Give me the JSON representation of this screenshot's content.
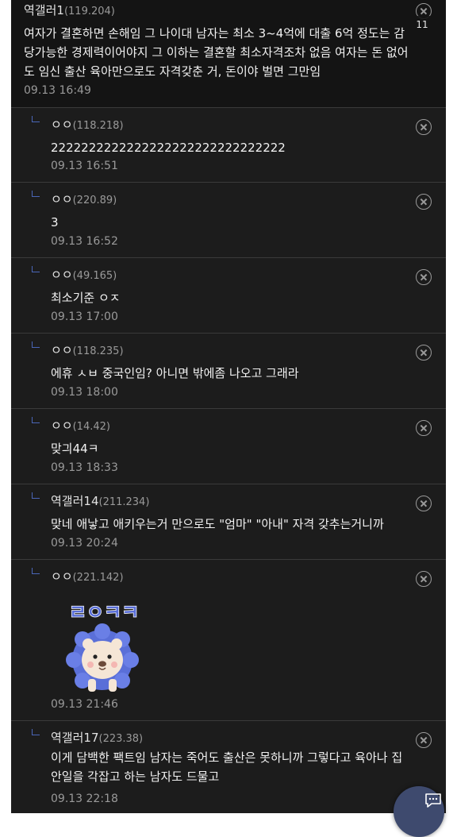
{
  "overlay": {
    "counter_badge": "11"
  },
  "comments": [
    {
      "author": "역갤러1",
      "ip": "(119.204)",
      "body": "여자가 결혼하면 손해임 그 나이대 남자는 최소 3~4억에 대출 6억 정도는 감\n당가능한 경제력이어야지 그 이하는 결혼할 최소자격조차 없음 여자는 돈 없어\n도 임신 출산 육아만으로도 자격갖춘 거, 돈이야 벌면 그만임",
      "date": "09.13 16:49"
    },
    {
      "author": "ㅇㅇ",
      "ip": "(118.218)",
      "body": "2222222222222222222222222222222",
      "date": "09.13 16:51"
    },
    {
      "author": "ㅇㅇ",
      "ip": "(220.89)",
      "body": "3",
      "date": "09.13 16:52"
    },
    {
      "author": "ㅇㅇ",
      "ip": "(49.165)",
      "body": "최소기준 ㅇㅈ",
      "date": "09.13 17:00"
    },
    {
      "author": "ㅇㅇ",
      "ip": "(118.235)",
      "body": "에휴 ㅅㅂ 중국인임? 아니면 밖에좀 나오고 그래라",
      "date": "09.13 18:00"
    },
    {
      "author": "ㅇㅇ",
      "ip": "(14.42)",
      "body": "맞긔44ㅋ",
      "date": "09.13 18:33"
    },
    {
      "author": "역갤러14",
      "ip": "(211.234)",
      "body": "맞네 애낳고 애키우는거 만으로도 \"엄마\" \"아내\" 자격 갖추는거니까",
      "date": "09.13 20:24"
    },
    {
      "author": "ㅇㅇ",
      "ip": "(221.142)",
      "sticker_text": "ㄹㅇㅋㅋ",
      "date": "09.13 21:46"
    },
    {
      "author": "역갤러17",
      "ip": "(223.38)",
      "body": "이게 담백한 팩트임 남자는 죽어도 출산은 못하니까 그렇다고 육아나 집\n안일을 각잡고 하는 남자도 드물고",
      "date": "09.13 22:18"
    }
  ]
}
